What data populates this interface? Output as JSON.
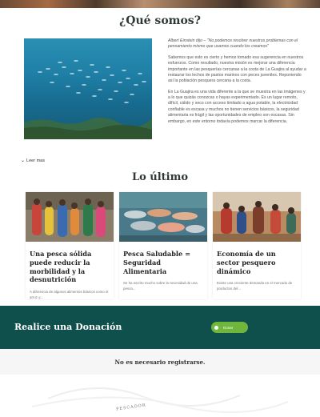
{
  "about": {
    "title": "¿Qué somos?",
    "quote": "Albert Einstein dijo – \"No podemos resolver nuestros problemas con el pensamiento mismo que usamos cuando los creamos\"",
    "p1": "Sabemos que esto es cierto y hemos tomado esa sugerencia en nuestros esfuerzos. Como resultado, nuestra misión es mejorar una diferencia importante en las pesquerías cercanas a la costa de La Guajira al ayudar a restaurar los lechos de pastos marinos con peces juveniles. Reponiendo así la población pesquera cercana a la costa.",
    "p2": "En La Guajira es una vida diferente a la que se muestra en las imágenes y a lo que quizás conozcas o hayas experimentado. Es un lugar remoto, difícil, cálido y seco con acceso limitado a agua potable, la electricidad confiable es escasa y muchos no tienen servicios básicos, la seguridad alimentaria es frágil y las oportunidades de empleo son escasas. Sin embargo, en este entorno todavía podemos marcar la diferencia.",
    "read_more": "Leer mas"
  },
  "latest": {
    "title": "Lo último",
    "cards": [
      {
        "title": "Una pesca sólida puede reducir la morbilidad y la desnutrición",
        "excerpt": "A diferencia de algunos alimentos básicos como el arroz y..."
      },
      {
        "title": "Pesca Saludable = Seguridad Alimentaria",
        "excerpt": "Se ha escrito mucho sobre la necesidad de una pesca..."
      },
      {
        "title": "Economía de un sector pesquero dinámico",
        "excerpt": "Existe una creciente demanda en el mercado de productos del..."
      }
    ]
  },
  "donation": {
    "title": "Realice una Donación",
    "button_label": "Donar",
    "button_color": "#6fb63c",
    "band_color": "#0f4f4c"
  },
  "register_note": "No es necesario registrarse.",
  "footer": {
    "logo_text": "PESCADOR"
  }
}
